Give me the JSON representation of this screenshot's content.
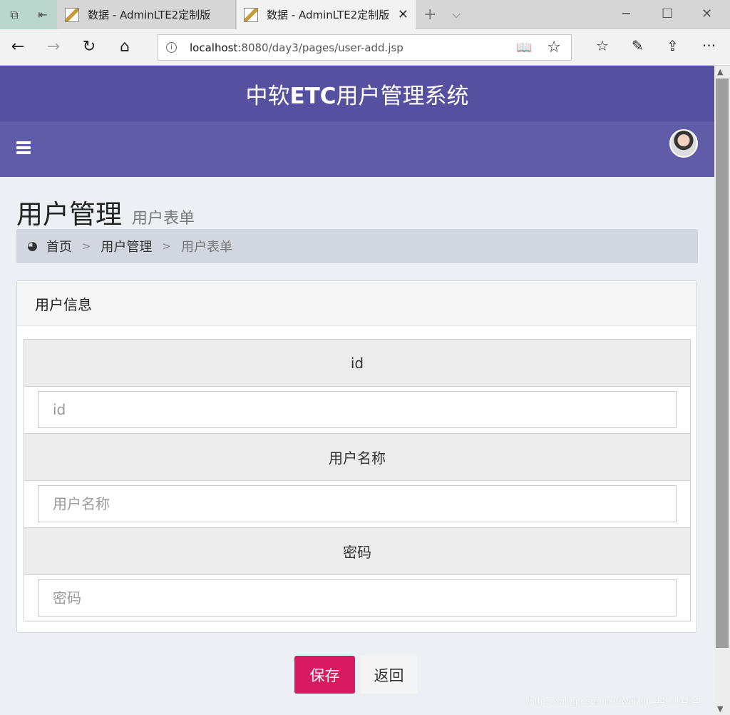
{
  "browser": {
    "tabs": [
      {
        "label": "数据 - AdminLTE2定制版",
        "active": false
      },
      {
        "label": "数据 - AdminLTE2定制版",
        "active": true
      }
    ],
    "new_tab": "+",
    "tab_list": "⌵",
    "window": {
      "minimize": "─",
      "maximize": "☐",
      "close": "✕"
    },
    "nav": {
      "back": "←",
      "forward": "→",
      "refresh": "↻",
      "home": "⌂"
    },
    "url_host": "localhost",
    "url_path": ":8080/day3/pages/user-add.jsp",
    "toolbar": {
      "favorites": "☆",
      "notes": "✎",
      "share": "⇪",
      "more": "···"
    }
  },
  "app": {
    "title_prefix": "中软",
    "title_strong": "ETC",
    "title_suffix": "用户管理系统"
  },
  "content": {
    "title": "用户管理",
    "subtitle": "用户表单",
    "breadcrumb": [
      "首页",
      "用户管理",
      "用户表单"
    ],
    "breadcrumb_sep": ">"
  },
  "form": {
    "box_title": "用户信息",
    "fields": [
      {
        "label": "id",
        "placeholder": "id",
        "value": ""
      },
      {
        "label": "用户名称",
        "placeholder": "用户名称",
        "value": ""
      },
      {
        "label": "密码",
        "placeholder": "密码",
        "value": ""
      }
    ],
    "save_label": "保存",
    "back_label": "返回"
  },
  "watermark": "https://blog.csdn.net/weixin_44030454",
  "colors": {
    "header": "#5551a0",
    "navbar": "#605ca8",
    "save_button": "#d81b60",
    "content_bg": "#ecf0f5"
  }
}
